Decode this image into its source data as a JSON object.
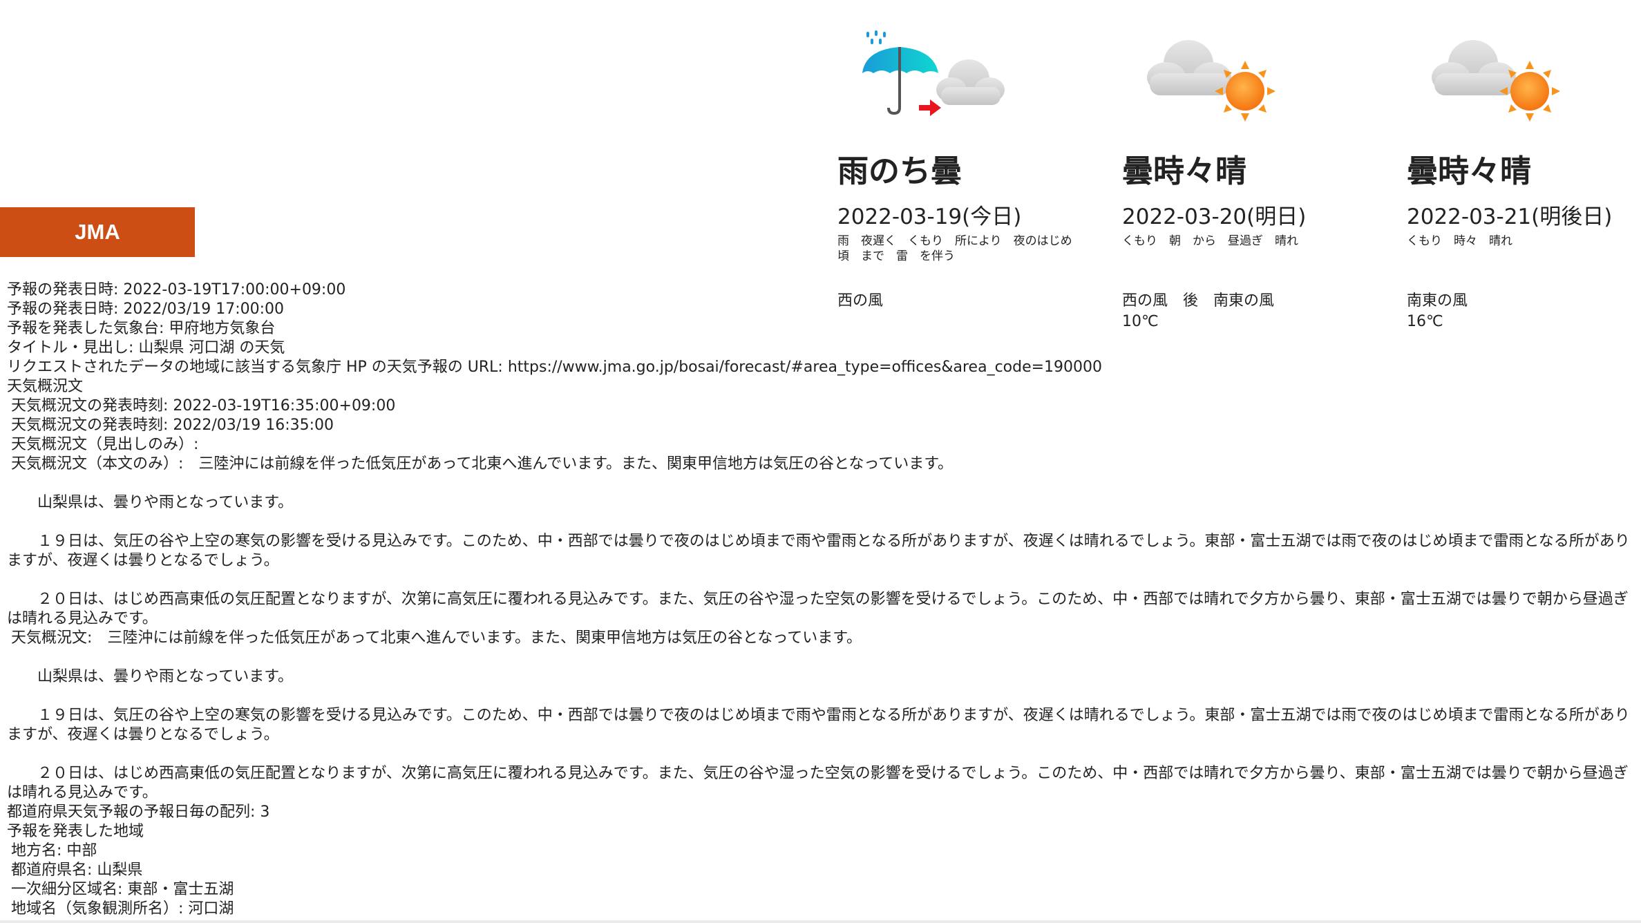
{
  "header": {
    "jma_button": "JMA",
    "jma_color": "#cc4e14"
  },
  "forecasts": [
    {
      "weather": "雨のち曇",
      "date": "2022-03-19(今日)",
      "detail": "雨　夜遅く　くもり　所により　夜のはじめ頃　まで　雷　を伴う",
      "wind": "西の風",
      "temp": "",
      "icons": [
        "umbrella-rain-icon",
        "arrow-right-icon",
        "cloud-icon"
      ]
    },
    {
      "weather": "曇時々晴",
      "date": "2022-03-20(明日)",
      "detail": "くもり　朝　から　昼過ぎ　晴れ",
      "wind": "西の風　後　南東の風",
      "temp": "10℃",
      "icons": [
        "cloud-icon",
        "sun-icon"
      ]
    },
    {
      "weather": "曇時々晴",
      "date": "2022-03-21(明後日)",
      "detail": "くもり　時々　晴れ",
      "wind": "南東の風",
      "temp": "16℃",
      "icons": [
        "cloud-icon",
        "sun-icon"
      ]
    }
  ],
  "info": {
    "report_datetime_iso": "予報の発表日時: 2022-03-19T17:00:00+09:00",
    "report_datetime": "予報の発表日時: 2022/03/19 17:00:00",
    "office": "予報を発表した気象台: 甲府地方気象台",
    "title": "タイトル・見出し: 山梨県 河口湖 の天気",
    "url": "リクエストされたデータの地域に該当する気象庁 HP の天気予報の URL: https://www.jma.go.jp/bosai/forecast/#area_type=offices&area_code=190000",
    "overview_label": "天気概況文",
    "overview_time_iso": "天気概況文の発表時刻: 2022-03-19T16:35:00+09:00",
    "overview_time": "天気概況文の発表時刻: 2022/03/19 16:35:00",
    "overview_headline": "天気概況文（見出しのみ）:",
    "overview_body_label": "天気概況文（本文のみ）:　三陸沖には前線を伴った低気圧があって北東へ進んでいます。また、関東甲信地方は気圧の谷となっています。",
    "p_yamanashi": "山梨県は、曇りや雨となっています。",
    "p_19": "１９日は、気圧の谷や上空の寒気の影響を受ける見込みです。このため、中・西部では曇りで夜のはじめ頃まで雨や雷雨となる所がありますが、夜遅くは晴れるでしょう。東部・富士五湖では雨で夜のはじめ頃まで雷雨となる所がありますが、夜遅くは曇りとなるでしょう。",
    "p_20": "２０日は、はじめ西高東低の気圧配置となりますが、次第に高気圧に覆われる見込みです。また、気圧の谷や湿った空気の影響を受けるでしょう。このため、中・西部では晴れで夕方から曇り、東部・富士五湖では曇りで朝から昼過ぎは晴れる見込みです。",
    "overview_full_label": "天気概況文:　三陸沖には前線を伴った低気圧があって北東へ進んでいます。また、関東甲信地方は気圧の谷となっています。",
    "array_count": "都道府県天気予報の予報日毎の配列: 3",
    "region_label": "予報を発表した地域",
    "region_area": "地方名: 中部",
    "region_pref": "都道府県名: 山梨県",
    "region_primary": "一次細分区域名: 東部・富士五湖",
    "region_station": "地域名（気象観測所名）: 河口湖"
  }
}
